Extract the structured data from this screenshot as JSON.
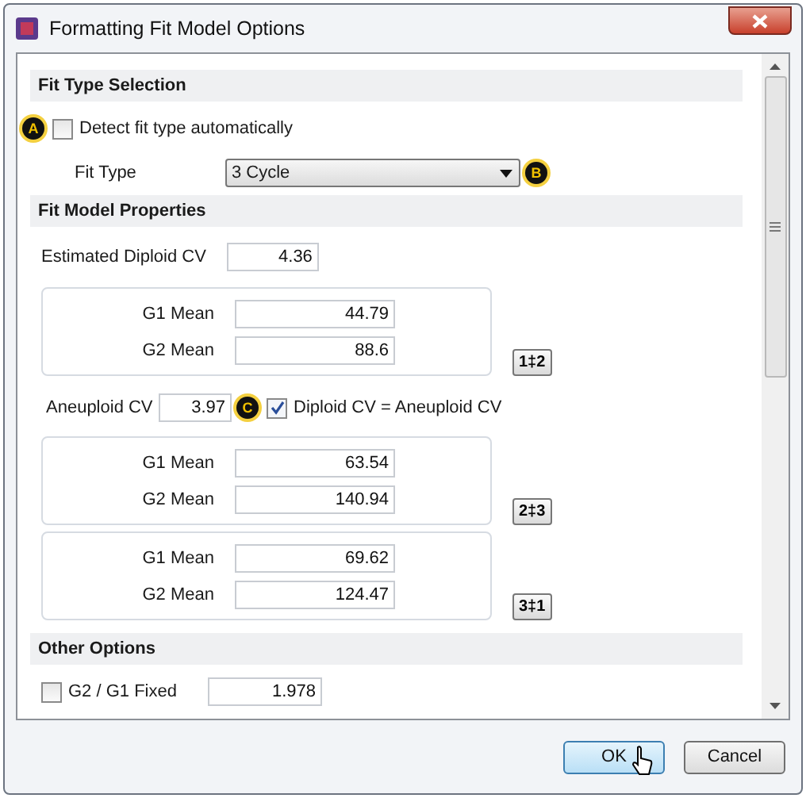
{
  "window": {
    "title": "Formatting Fit Model Options"
  },
  "fit_type_selection": {
    "title": "Fit Type Selection",
    "detect_auto": {
      "label": "Detect fit type automatically",
      "checked": false,
      "callout": "A"
    },
    "fit_type": {
      "label": "Fit Type",
      "value": "3 Cycle",
      "callout": "B"
    }
  },
  "fit_model_properties": {
    "title": "Fit Model Properties",
    "estimated_diploid_cv": {
      "label": "Estimated Diploid CV",
      "value": "4.36"
    },
    "items": [
      {
        "kind": "group",
        "rows": [
          {
            "label": "G1 Mean",
            "value": "44.79"
          },
          {
            "label": "G2 Mean",
            "value": "88.6"
          }
        ],
        "swap_button": "1‡2"
      },
      {
        "kind": "cv",
        "label": "Aneuploid CV",
        "value": "3.97",
        "callout": "C",
        "checkbox": {
          "label": "Diploid CV = Aneuploid CV",
          "checked": true
        }
      },
      {
        "kind": "group",
        "rows": [
          {
            "label": "G1 Mean",
            "value": "63.54"
          },
          {
            "label": "G2 Mean",
            "value": "140.94"
          }
        ],
        "swap_button": "2‡3"
      },
      {
        "kind": "group",
        "rows": [
          {
            "label": "G1 Mean",
            "value": "69.62"
          },
          {
            "label": "G2 Mean",
            "value": "124.47"
          }
        ],
        "swap_button": "3‡1"
      }
    ]
  },
  "other_options": {
    "title": "Other Options",
    "g2_g1_fixed": {
      "label": "G2 / G1 Fixed",
      "checked": false,
      "value": "1.978"
    }
  },
  "buttons": [
    {
      "label": "OK",
      "default": true
    },
    {
      "label": "Cancel",
      "default": false
    }
  ]
}
